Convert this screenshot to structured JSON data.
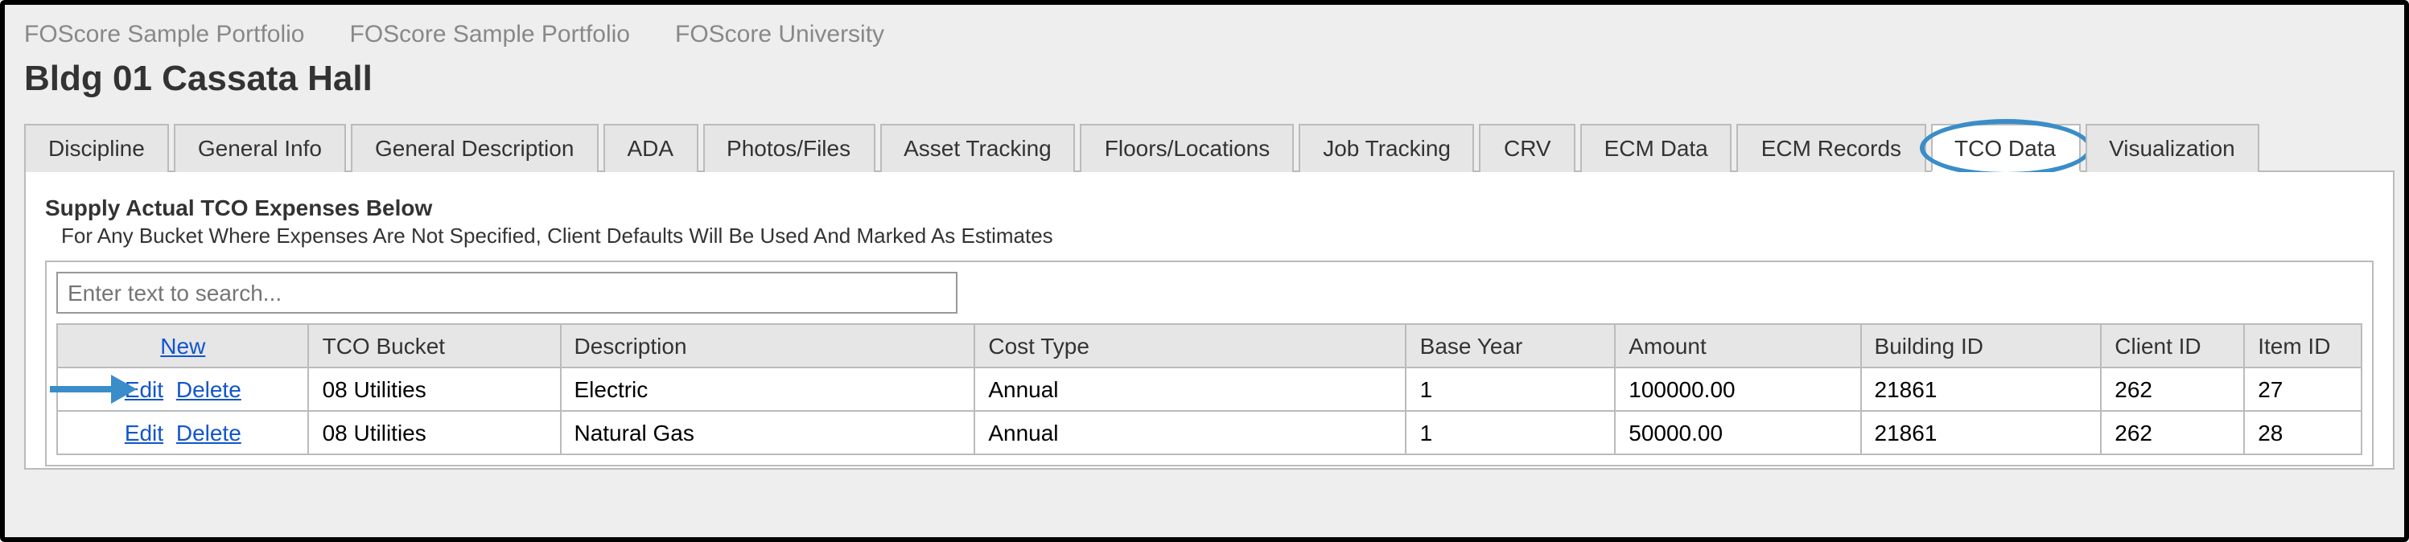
{
  "breadcrumb": [
    "FOScore Sample Portfolio",
    "FOScore Sample Portfolio",
    "FOScore University"
  ],
  "page_title": "Bldg 01 Cassata Hall",
  "tabs": [
    {
      "label": "Discipline"
    },
    {
      "label": "General Info"
    },
    {
      "label": "General Description"
    },
    {
      "label": "ADA"
    },
    {
      "label": "Photos/Files"
    },
    {
      "label": "Asset Tracking"
    },
    {
      "label": "Floors/Locations"
    },
    {
      "label": "Job Tracking"
    },
    {
      "label": "CRV"
    },
    {
      "label": "ECM Data"
    },
    {
      "label": "ECM Records"
    },
    {
      "label": "TCO Data",
      "active": true,
      "highlight": true
    },
    {
      "label": "Visualization"
    }
  ],
  "section": {
    "title": "Supply Actual TCO Expenses Below",
    "note": "For Any Bucket Where Expenses Are Not Specified, Client Defaults Will Be Used And Marked As Estimates",
    "search_placeholder": "Enter text to search..."
  },
  "grid": {
    "new_label": "New",
    "edit_label": "Edit",
    "delete_label": "Delete",
    "columns": [
      "TCO Bucket",
      "Description",
      "Cost Type",
      "Base Year",
      "Amount",
      "Building ID",
      "Client ID",
      "Item ID"
    ],
    "numeric_cols": [
      3,
      4,
      5,
      6,
      7
    ],
    "rows": [
      {
        "tco_bucket": "08 Utilities",
        "description": "Electric",
        "cost_type": "Annual",
        "base_year": "1",
        "amount": "100000.00",
        "building_id": "21861",
        "client_id": "262",
        "item_id": "27",
        "arrow": true
      },
      {
        "tco_bucket": "08 Utilities",
        "description": "Natural Gas",
        "cost_type": "Annual",
        "base_year": "1",
        "amount": "50000.00",
        "building_id": "21861",
        "client_id": "262",
        "item_id": "28"
      }
    ]
  }
}
